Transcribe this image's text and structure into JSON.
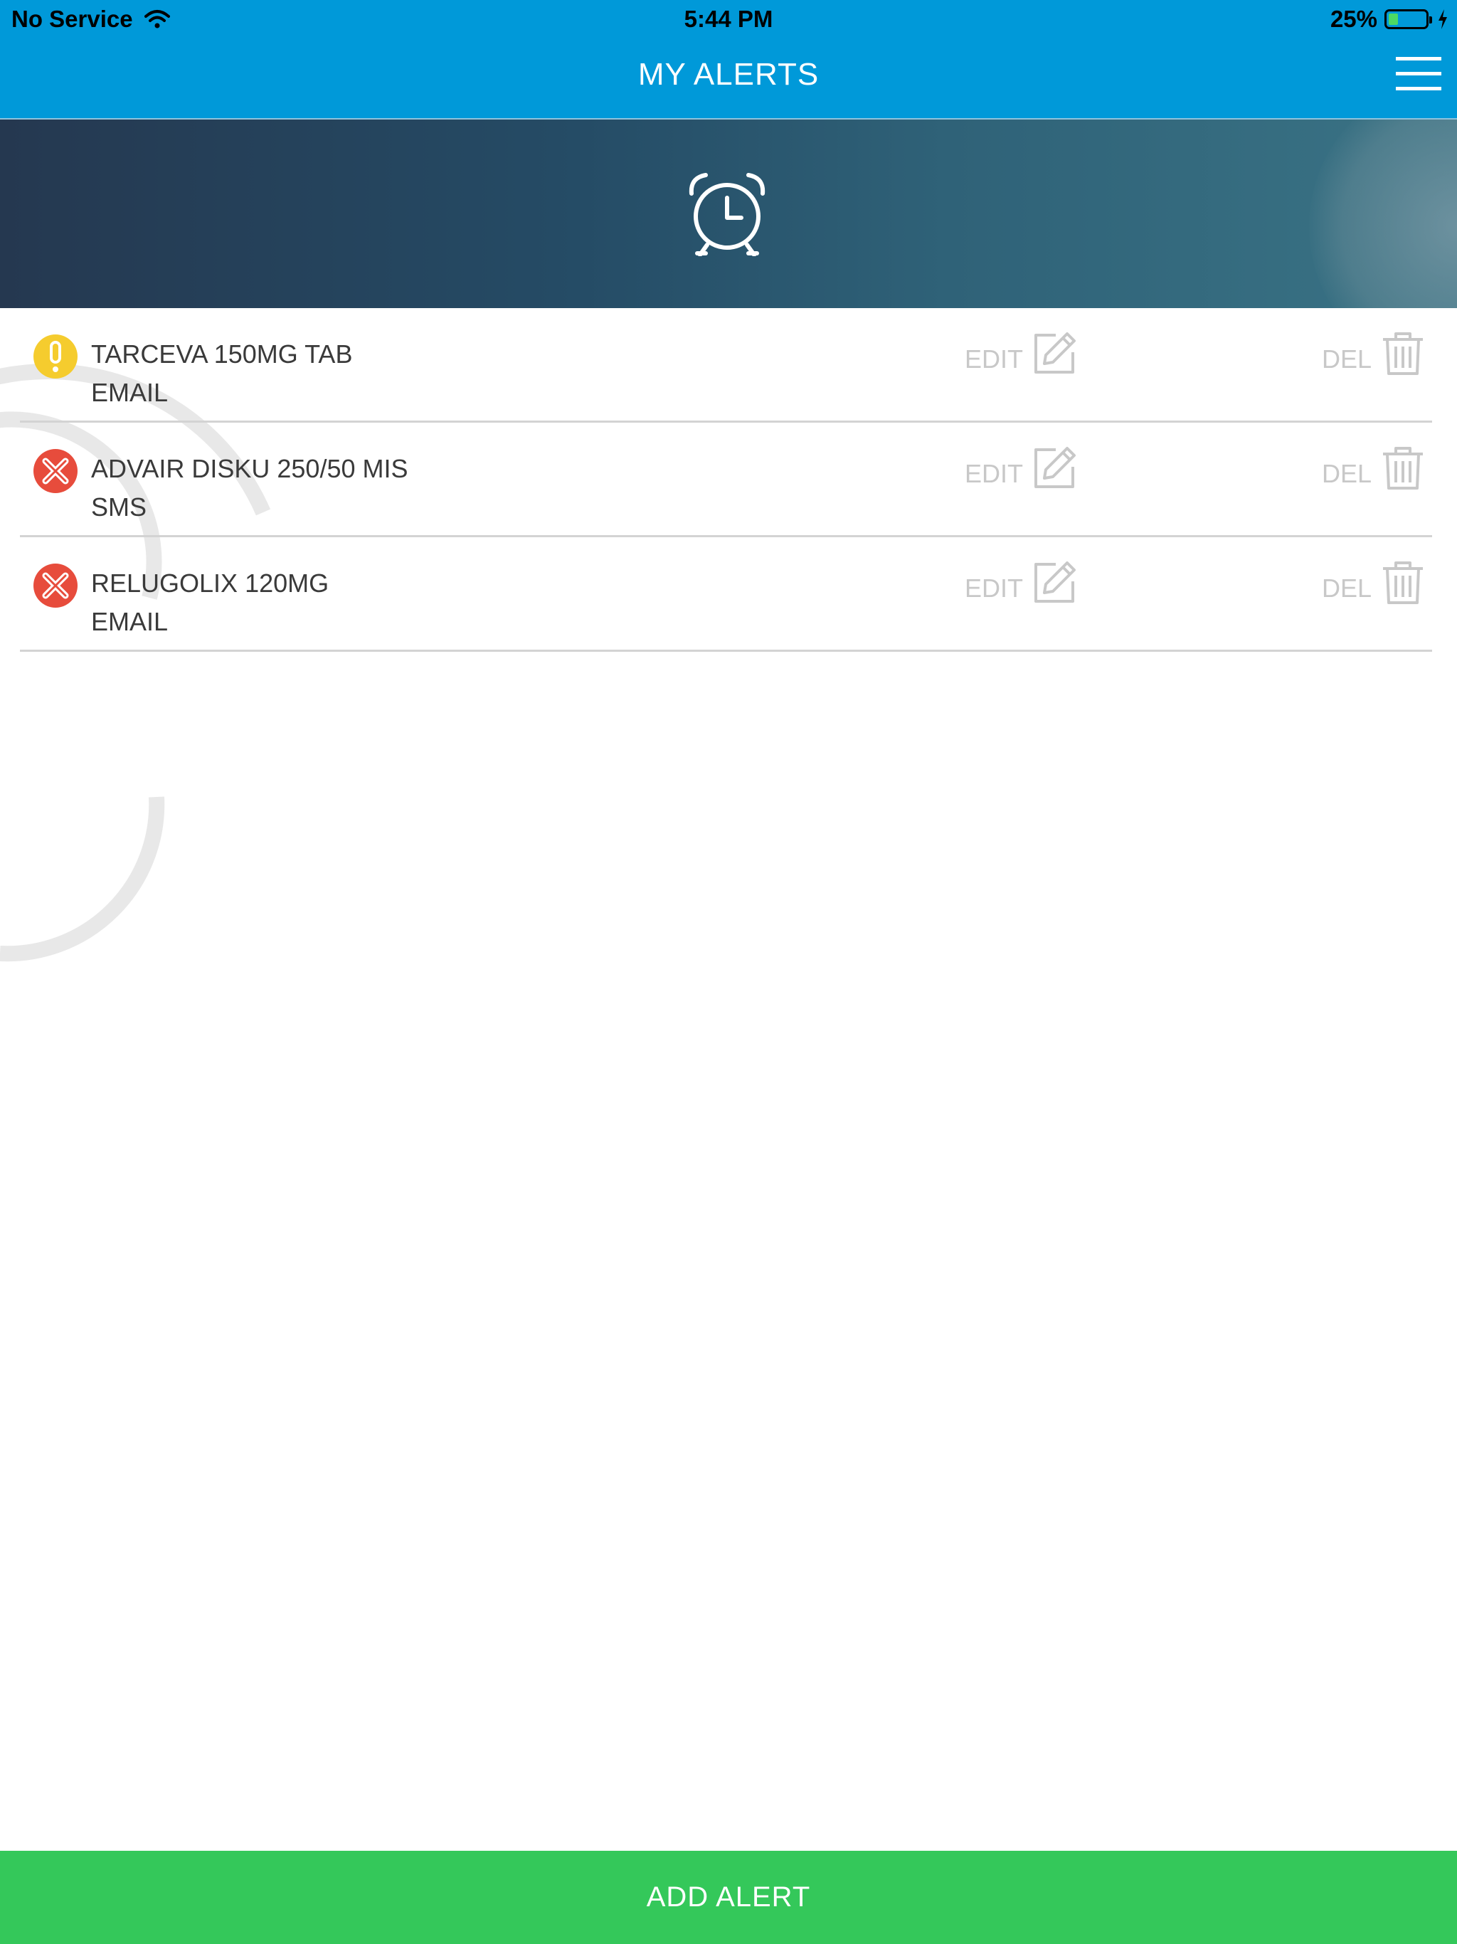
{
  "status_bar": {
    "carrier": "No Service",
    "time": "5:44 PM",
    "battery_percent_label": "25%",
    "battery_level": 0.25,
    "wifi_icon": "wifi-icon",
    "charging_icon": "bolt-icon"
  },
  "header": {
    "title": "MY ALERTS",
    "menu_icon": "hamburger-menu-icon"
  },
  "banner": {
    "icon": "alarm-clock-icon"
  },
  "alerts": [
    {
      "name": "TARCEVA 150MG TAB",
      "channel": "EMAIL",
      "status": "warning",
      "status_color": "#f5cc2e",
      "edit_label": "EDIT",
      "delete_label": "DEL"
    },
    {
      "name": "ADVAIR DISKU 250/50 MIS",
      "channel": "SMS",
      "status": "error",
      "status_color": "#e74c3c",
      "edit_label": "EDIT",
      "delete_label": "DEL"
    },
    {
      "name": "RELUGOLIX 120MG",
      "channel": "EMAIL",
      "status": "error",
      "status_color": "#e74c3c",
      "edit_label": "EDIT",
      "delete_label": "DEL"
    }
  ],
  "footer": {
    "add_label": "ADD ALERT"
  },
  "colors": {
    "nav": "#0099d9",
    "add_button": "#34c85a",
    "action_gray": "#c8c8c8"
  }
}
